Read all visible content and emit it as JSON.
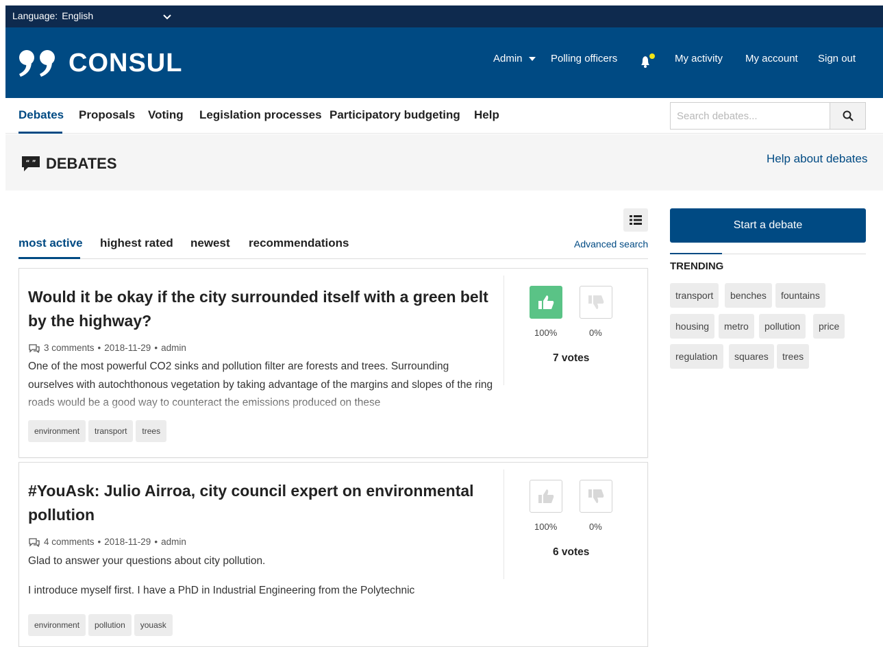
{
  "language": {
    "label": "Language:",
    "value": "English"
  },
  "header": {
    "brand": "CONSUL",
    "admin": "Admin",
    "polling_officers": "Polling officers",
    "my_activity": "My activity",
    "my_account": "My account",
    "sign_out": "Sign out"
  },
  "nav": {
    "items": [
      "Debates",
      "Proposals",
      "Voting",
      "Legislation processes",
      "Participatory budgeting",
      "Help"
    ],
    "search_placeholder": "Search debates..."
  },
  "section": {
    "title": "DEBATES",
    "help_link": "Help about debates"
  },
  "tabs": [
    "most active",
    "highest rated",
    "newest",
    "recommendations"
  ],
  "advanced_search": "Advanced search",
  "debates": [
    {
      "title": "Would it be okay if the city surrounded itself with a green belt by the highway?",
      "comments": "3 comments",
      "date": "2018-11-29",
      "author": "admin",
      "desc": "One of the most powerful CO2 sinks and pollution filter are forests and trees. Surrounding ourselves with autochthonous vegetation by taking advantage of the margins and slopes of the ring roads would be a good way to counteract the emissions produced on these",
      "tags": [
        "environment",
        "transport",
        "trees"
      ],
      "up": "100%",
      "down": "0%",
      "votes": "7 votes"
    },
    {
      "title": "#YouAsk: Julio Airroa, city council expert on environmental pollution",
      "comments": "4 comments",
      "date": "2018-11-29",
      "author": "admin",
      "desc": "Glad to answer your questions about city pollution.",
      "desc2": "I introduce myself first. I have a PhD in Industrial Engineering from the Polytechnic",
      "tags": [
        "environment",
        "pollution",
        "youask"
      ],
      "up": "100%",
      "down": "0%",
      "votes": "6 votes"
    }
  ],
  "sidebar": {
    "start_button": "Start a debate",
    "trending_title": "TRENDING",
    "trending": [
      "transport",
      "benches",
      "fountains",
      "housing",
      "metro",
      "pollution",
      "price",
      "regulation",
      "squares",
      "trees"
    ]
  },
  "colors": {
    "primary": "#004a83",
    "topbar": "#0e2a4e",
    "upvote": "#5ac386",
    "notify_dot": "#f2e416"
  }
}
